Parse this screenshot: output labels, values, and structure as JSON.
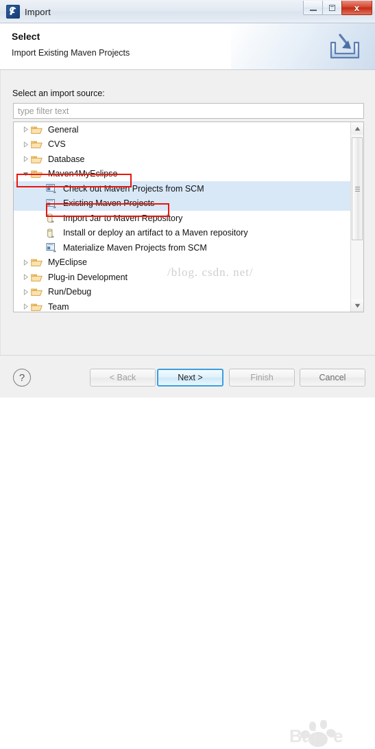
{
  "window": {
    "title": "Import",
    "app_icon": "wrench-icon",
    "controls": {
      "minimize": "minimize-icon",
      "maximize": "maximize-icon",
      "close": "x"
    }
  },
  "header": {
    "title": "Select",
    "subtitle": "Import Existing Maven Projects",
    "icon": "import-arrow-icon"
  },
  "main": {
    "source_label": "Select an import source:",
    "filter": {
      "value": "",
      "placeholder": "type filter text"
    },
    "tree": [
      {
        "label": "General",
        "depth": 0,
        "icon": "folder-icon",
        "state": "collapsed",
        "selected": false
      },
      {
        "label": "CVS",
        "depth": 0,
        "icon": "folder-icon",
        "state": "collapsed",
        "selected": false
      },
      {
        "label": "Database",
        "depth": 0,
        "icon": "folder-icon",
        "state": "collapsed",
        "selected": false
      },
      {
        "label": "Maven4MyEclipse",
        "depth": 0,
        "icon": "folder-icon",
        "state": "expanded",
        "selected": false,
        "highlighted": true
      },
      {
        "label": "Check out Maven Projects from SCM",
        "depth": 1,
        "icon": "maven-scm-icon",
        "state": "leaf",
        "selected": true
      },
      {
        "label": "Existing Maven Projects",
        "depth": 1,
        "icon": "maven-scm-icon",
        "state": "leaf",
        "selected": true,
        "highlighted": true
      },
      {
        "label": "Import Jar to Maven Repository",
        "depth": 1,
        "icon": "jar-icon",
        "state": "leaf",
        "selected": false
      },
      {
        "label": "Install or deploy an artifact to a Maven repository",
        "depth": 1,
        "icon": "jar-icon",
        "state": "leaf",
        "selected": false
      },
      {
        "label": "Materialize Maven Projects from SCM",
        "depth": 1,
        "icon": "maven-scm-icon",
        "state": "leaf",
        "selected": false
      },
      {
        "label": "MyEclipse",
        "depth": 0,
        "icon": "folder-icon",
        "state": "collapsed",
        "selected": false
      },
      {
        "label": "Plug-in Development",
        "depth": 0,
        "icon": "folder-icon",
        "state": "collapsed",
        "selected": false
      },
      {
        "label": "Run/Debug",
        "depth": 0,
        "icon": "folder-icon",
        "state": "collapsed",
        "selected": false
      },
      {
        "label": "Team",
        "depth": 0,
        "icon": "folder-icon",
        "state": "collapsed",
        "selected": false
      }
    ],
    "scrollbar": {
      "up_arrow": "triangle-up-icon",
      "down_arrow": "triangle-down-icon"
    }
  },
  "footer": {
    "help": "?",
    "back": "< Back",
    "next": "Next >",
    "finish": "Finish",
    "cancel": "Cancel"
  },
  "watermarks": {
    "csdn": "/blog. csdn. net/"
  },
  "colors": {
    "annotation_red": "#e8160c",
    "selection_blue": "#d9e8f7",
    "focus_blue": "#3c9ede",
    "close_red": "#c32d16",
    "folder_orange": "#f2c36b"
  }
}
